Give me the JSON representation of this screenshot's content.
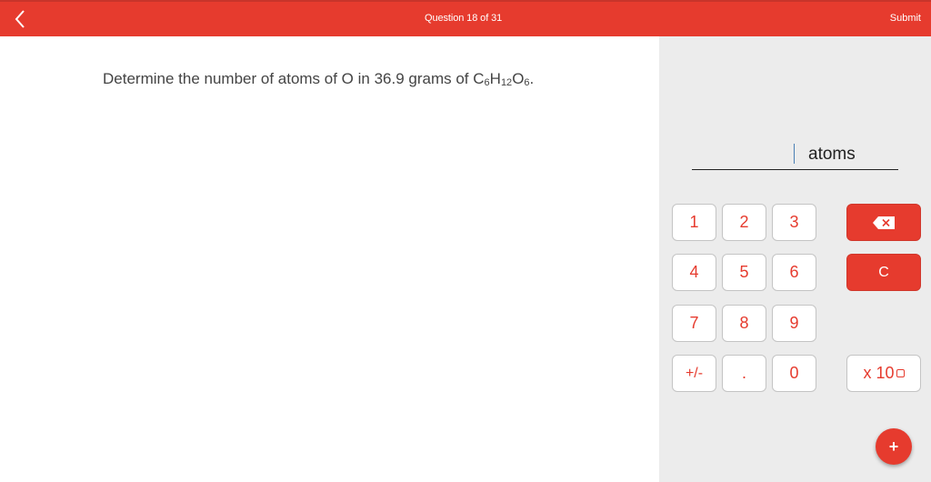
{
  "header": {
    "back_icon": "chevron-left-icon",
    "question_counter": "Question 18 of 31",
    "submit_label": "Submit"
  },
  "question": {
    "prefix": "Determine the number of atoms of O in 36.9 grams of ",
    "formula": [
      {
        "el": "C",
        "n": "6"
      },
      {
        "el": "H",
        "n": "12"
      },
      {
        "el": "O",
        "n": "6"
      }
    ],
    "suffix": "."
  },
  "answer": {
    "value": "",
    "unit": "atoms"
  },
  "keypad": {
    "keys": [
      {
        "label": "1"
      },
      {
        "label": "2"
      },
      {
        "label": "3"
      },
      {
        "label": "4"
      },
      {
        "label": "5"
      },
      {
        "label": "6"
      },
      {
        "label": "7"
      },
      {
        "label": "8"
      },
      {
        "label": "9"
      },
      {
        "label": "+/-"
      },
      {
        "label": "."
      },
      {
        "label": "0"
      }
    ],
    "backspace_icon": "backspace-icon",
    "clear_label": "C",
    "exponent_label": "x 10",
    "add_icon": "+"
  },
  "colors": {
    "accent": "#e63b2e",
    "panel": "#ececec"
  }
}
